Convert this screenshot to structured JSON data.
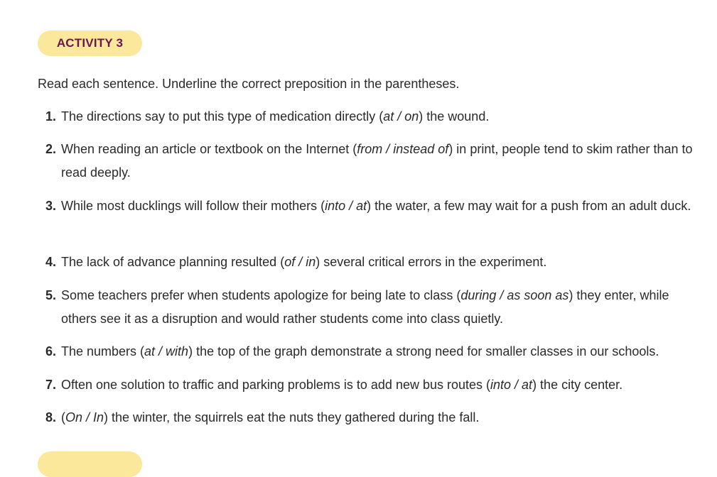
{
  "activity": {
    "badge": "ACTIVITY 3",
    "instructions": "Read each sentence. Underline the correct preposition in the parentheses."
  },
  "items": [
    {
      "num": "1.",
      "before": "The directions say to put this type of medication directly (",
      "choice": "at / on",
      "after": ") the wound."
    },
    {
      "num": "2.",
      "before": "When reading an article or textbook on the Internet (",
      "choice": "from / instead of",
      "after": ") in print, people tend to skim rather than to read deeply."
    },
    {
      "num": "3.",
      "before": "While most ducklings will follow their mothers (",
      "choice": "into / at",
      "after": ") the water, a few may wait for a push from an adult duck."
    },
    {
      "num": "4.",
      "before": "The lack of advance planning resulted (",
      "choice": "of / in",
      "after": ") several critical errors in the experiment."
    },
    {
      "num": "5.",
      "before": "Some teachers prefer when students apologize for being late to class (",
      "choice": "during / as soon as",
      "after": ") they enter, while others see it as a disruption and would rather students come into class quietly."
    },
    {
      "num": "6.",
      "before": "The numbers (",
      "choice": "at / with",
      "after": ") the top of the graph demonstrate a strong need for smaller classes in our schools."
    },
    {
      "num": "7.",
      "before": "Often one solution to traffic and parking problems is to add new bus routes (",
      "choice": "into / at",
      "after": ") the city center."
    },
    {
      "num": "8.",
      "before": "(",
      "choice": "On / In",
      "after": ") the winter, the squirrels eat the nuts they gathered during the fall."
    }
  ]
}
